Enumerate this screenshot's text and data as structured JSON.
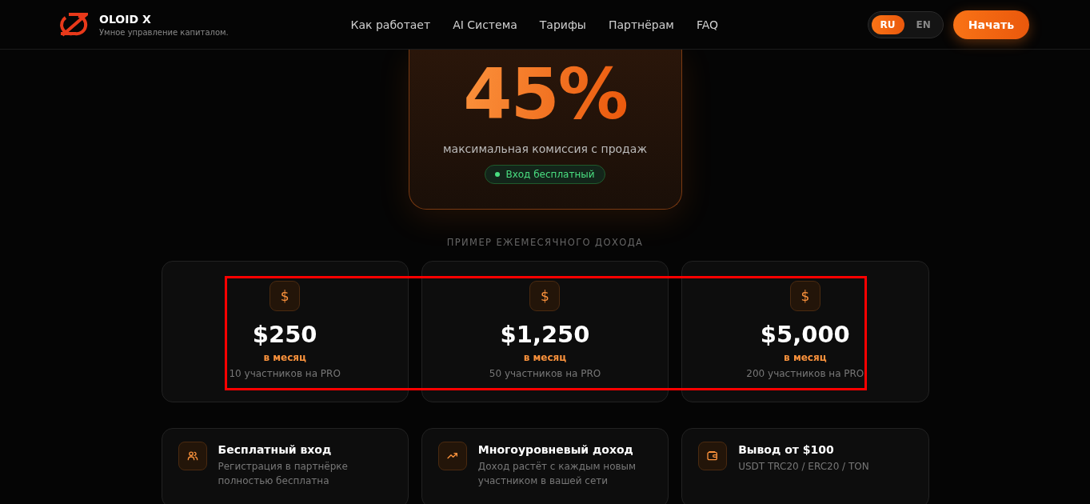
{
  "header": {
    "brand": {
      "name": "OLOID X",
      "tagline": "Умное управление капиталом."
    },
    "nav": [
      "Как работает",
      "AI Система",
      "Тарифы",
      "Партнёрам",
      "FAQ"
    ],
    "languages": [
      {
        "label": "RU",
        "selected": true
      },
      {
        "label": "EN",
        "selected": false
      }
    ],
    "cta": "Начать"
  },
  "hero": {
    "value": "45%",
    "caption": "максимальная комиссия с продаж",
    "badge": "Вход бесплатный"
  },
  "income": {
    "title": "ПРИМЕР ЕЖЕМЕСЯЧНОГО ДОХОДА",
    "cards": [
      {
        "icon": "$",
        "amount": "$250",
        "period": "в месяц",
        "note": "10 участников на PRO"
      },
      {
        "icon": "$",
        "amount": "$1,250",
        "period": "в месяц",
        "note": "50 участников на PRO"
      },
      {
        "icon": "$",
        "amount": "$5,000",
        "period": "в месяц",
        "note": "200 участников на PRO"
      }
    ],
    "highlighted": true
  },
  "features": [
    {
      "kind": "users",
      "title": "Бесплатный вход",
      "text": "Регистрация в партнёрке полностью бесплатна"
    },
    {
      "kind": "trend",
      "title": "Многоуровневый доход",
      "text": "Доход растёт с каждым новым участником в вашей сети"
    },
    {
      "kind": "wallet",
      "title": "Вывод от $100",
      "text": "USDT TRC20 / ERC20 / TON"
    }
  ]
}
